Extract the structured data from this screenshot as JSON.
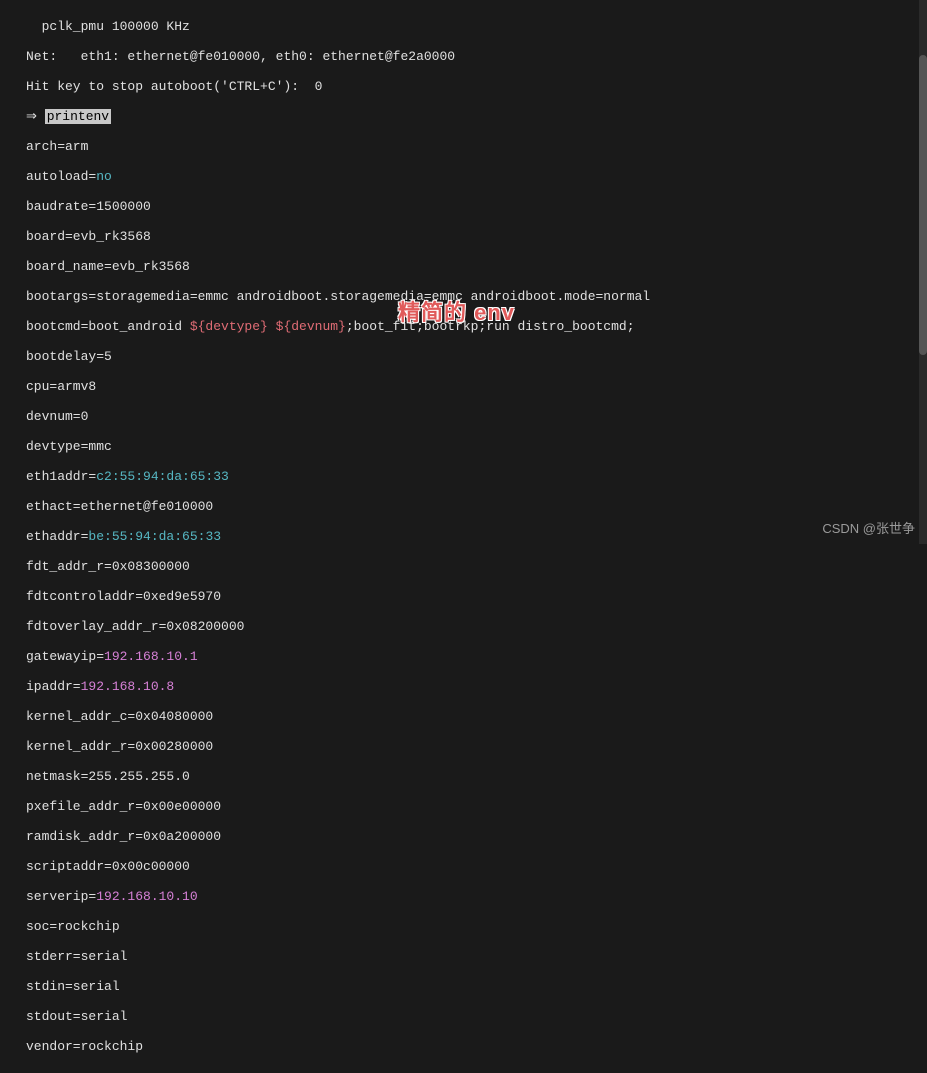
{
  "header": {
    "pclk": "  pclk_pmu 100000 KHz",
    "net": "Net:   eth1: ethernet@fe010000, eth0: ethernet@fe2a0000",
    "hit": "Hit key to stop autoboot('CTRL+C'):  0",
    "prompt_arrow": "⇒ ",
    "command": "printenv"
  },
  "env": {
    "arch": "arch=arm",
    "autoload_k": "autoload=",
    "autoload_v": "no",
    "baudrate": "baudrate=1500000",
    "board": "board=evb_rk3568",
    "board_name": "board_name=evb_rk3568",
    "bootargs": "bootargs=storagemedia=emmc androidboot.storagemedia=emmc androidboot.mode=normal",
    "bootcmd_pre": "bootcmd=boot_android ",
    "bootcmd_vars": "${devtype} ${devnum}",
    "bootcmd_post": ";boot_fit;bootrkp;run distro_bootcmd;",
    "bootdelay": "bootdelay=5",
    "cpu": "cpu=armv8",
    "devnum": "devnum=0",
    "devtype": "devtype=mmc",
    "eth1addr_k": "eth1addr=",
    "eth1addr_v": "c2:55:94:da:65:33",
    "ethact": "ethact=ethernet@fe010000",
    "ethaddr_k": "ethaddr=",
    "ethaddr_v": "be:55:94:da:65:33",
    "fdt_addr_r": "fdt_addr_r=0x08300000",
    "fdtcontroladdr": "fdtcontroladdr=0xed9e5970",
    "fdtoverlay_addr_r": "fdtoverlay_addr_r=0x08200000",
    "gatewayip_k": "gatewayip=",
    "gatewayip_v": "192.168.10.1",
    "ipaddr_k": "ipaddr=",
    "ipaddr_v": "192.168.10.8",
    "kernel_addr_c": "kernel_addr_c=0x04080000",
    "kernel_addr_r": "kernel_addr_r=0x00280000",
    "netmask": "netmask=255.255.255.0",
    "pxefile_addr_r": "pxefile_addr_r=0x00e00000",
    "ramdisk_addr_r": "ramdisk_addr_r=0x0a200000",
    "scriptaddr": "scriptaddr=0x00c00000",
    "serverip_k": "serverip=",
    "serverip_v": "192.168.10.10",
    "soc": "soc=rockchip",
    "stderr": "stderr=serial",
    "stdin": "stdin=serial",
    "stdout": "stdout=serial",
    "vendor": "vendor=rockchip"
  },
  "annotation": "精简的 env",
  "watermark": "CSDN @张世争"
}
